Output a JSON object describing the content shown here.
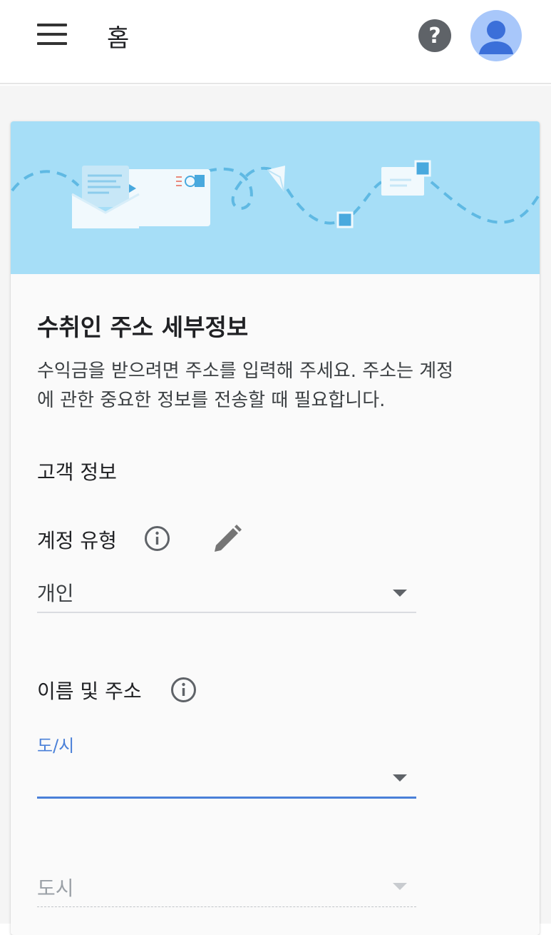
{
  "appbar": {
    "title": "홈",
    "menu_icon": "menu-icon",
    "help_icon": "help-icon",
    "help_glyph": "?",
    "avatar_icon": "account-avatar-icon"
  },
  "banner": {
    "illustration": "mail-envelopes-illustration",
    "colors": {
      "background": "#a6def7",
      "dash": "#5fb9e3",
      "envelope": "#f1f9fd",
      "stamp": "#49a9de"
    }
  },
  "card": {
    "title": "수취인 주소 세부정보",
    "description_line1": "수익금을 받으려면 주소를 입력해 주세요. 주소는 계정",
    "description_line2": "에 관한 중요한 정보를 전송할 때 필요합니다."
  },
  "customer_info": {
    "label": "고객 정보"
  },
  "account_type": {
    "label": "계정 유형",
    "info_icon": "info-icon",
    "edit_icon": "edit-pencil-icon",
    "selected_value": "개인"
  },
  "name_address": {
    "label": "이름 및 주소",
    "info_icon": "info-icon"
  },
  "province_field": {
    "label": "도/시",
    "value": "",
    "accent_color": "#4a80d8"
  },
  "city_field": {
    "placeholder": "도시"
  }
}
